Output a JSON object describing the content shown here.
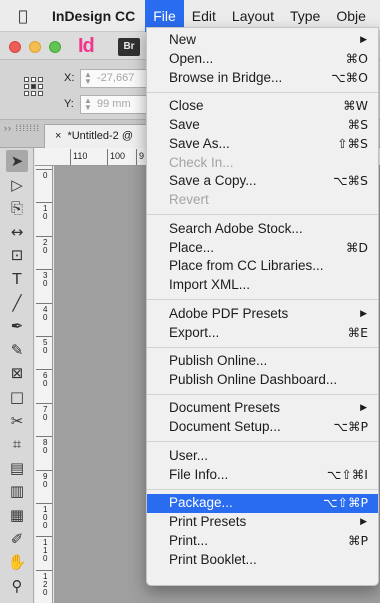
{
  "menubar": {
    "apple_icon": "apple-icon",
    "app_name": "InDesign CC",
    "menus": [
      "File",
      "Edit",
      "Layout",
      "Type",
      "Obje"
    ],
    "active_menu": "File"
  },
  "window": {
    "app_logo": "Id",
    "bridge_badge": "Br"
  },
  "control_panel": {
    "x_label": "X:",
    "x_value": "-27,667",
    "y_label": "Y:",
    "y_value": "99 mm"
  },
  "document": {
    "tab_close": "×",
    "tab_title": "*Untitled-2 @",
    "panel_grip": "›› ⁞⁞⁞⁞⁞⁞⁞"
  },
  "ruler": {
    "horizontal_ticks": [
      "110",
      "100",
      "9"
    ],
    "vertical_ticks": [
      "0",
      "10",
      "20",
      "30",
      "40",
      "50",
      "60",
      "70",
      "80",
      "90",
      "100",
      "110",
      "120"
    ]
  },
  "tools": [
    {
      "name": "selection-tool",
      "glyph": "➤"
    },
    {
      "name": "direct-selection-tool",
      "glyph": "▷"
    },
    {
      "name": "page-tool",
      "glyph": "⎘"
    },
    {
      "name": "gap-tool",
      "glyph": "↔"
    },
    {
      "name": "content-collector-tool",
      "glyph": "⊡"
    },
    {
      "name": "type-tool",
      "glyph": "T"
    },
    {
      "name": "line-tool",
      "glyph": "╱"
    },
    {
      "name": "pen-tool",
      "glyph": "✒"
    },
    {
      "name": "pencil-tool",
      "glyph": "✎"
    },
    {
      "name": "rectangle-frame-tool",
      "glyph": "⊠"
    },
    {
      "name": "rectangle-tool",
      "glyph": "□"
    },
    {
      "name": "scissors-tool",
      "glyph": "✂"
    },
    {
      "name": "free-transform-tool",
      "glyph": "⌗"
    },
    {
      "name": "gradient-swatch-tool",
      "glyph": "▤"
    },
    {
      "name": "gradient-feather-tool",
      "glyph": "▥"
    },
    {
      "name": "note-tool",
      "glyph": "▦"
    },
    {
      "name": "eyedropper-tool",
      "glyph": "✐"
    },
    {
      "name": "hand-tool",
      "glyph": "✋"
    },
    {
      "name": "zoom-tool",
      "glyph": "⚲"
    }
  ],
  "file_menu": {
    "items": [
      {
        "label": "New",
        "shortcut": "",
        "submenu": true
      },
      {
        "label": "Open...",
        "shortcut": "⌘O"
      },
      {
        "label": "Browse in Bridge...",
        "shortcut": "⌥⌘O"
      },
      {
        "separator": true
      },
      {
        "label": "Close",
        "shortcut": "⌘W"
      },
      {
        "label": "Save",
        "shortcut": "⌘S"
      },
      {
        "label": "Save As...",
        "shortcut": "⇧⌘S"
      },
      {
        "label": "Check In...",
        "shortcut": "",
        "disabled": true
      },
      {
        "label": "Save a Copy...",
        "shortcut": "⌥⌘S"
      },
      {
        "label": "Revert",
        "shortcut": "",
        "disabled": true
      },
      {
        "separator": true
      },
      {
        "label": "Search Adobe Stock...",
        "shortcut": ""
      },
      {
        "label": "Place...",
        "shortcut": "⌘D"
      },
      {
        "label": "Place from CC Libraries...",
        "shortcut": ""
      },
      {
        "label": "Import XML...",
        "shortcut": ""
      },
      {
        "separator": true
      },
      {
        "label": "Adobe PDF Presets",
        "shortcut": "",
        "submenu": true
      },
      {
        "label": "Export...",
        "shortcut": "⌘E"
      },
      {
        "separator": true
      },
      {
        "label": "Publish Online...",
        "shortcut": ""
      },
      {
        "label": "Publish Online Dashboard...",
        "shortcut": ""
      },
      {
        "separator": true
      },
      {
        "label": "Document Presets",
        "shortcut": "",
        "submenu": true
      },
      {
        "label": "Document Setup...",
        "shortcut": "⌥⌘P"
      },
      {
        "separator": true
      },
      {
        "label": "User...",
        "shortcut": ""
      },
      {
        "label": "File Info...",
        "shortcut": "⌥⇧⌘I"
      },
      {
        "separator": true
      },
      {
        "label": "Package...",
        "shortcut": "⌥⇧⌘P",
        "highlighted": true
      },
      {
        "label": "Print Presets",
        "shortcut": "",
        "submenu": true
      },
      {
        "label": "Print...",
        "shortcut": "⌘P"
      },
      {
        "label": "Print Booklet...",
        "shortcut": ""
      }
    ],
    "submenu_glyph": "▶"
  },
  "colors": {
    "highlight": "#2a6cf0",
    "indesign_pink": "#f0368f"
  }
}
